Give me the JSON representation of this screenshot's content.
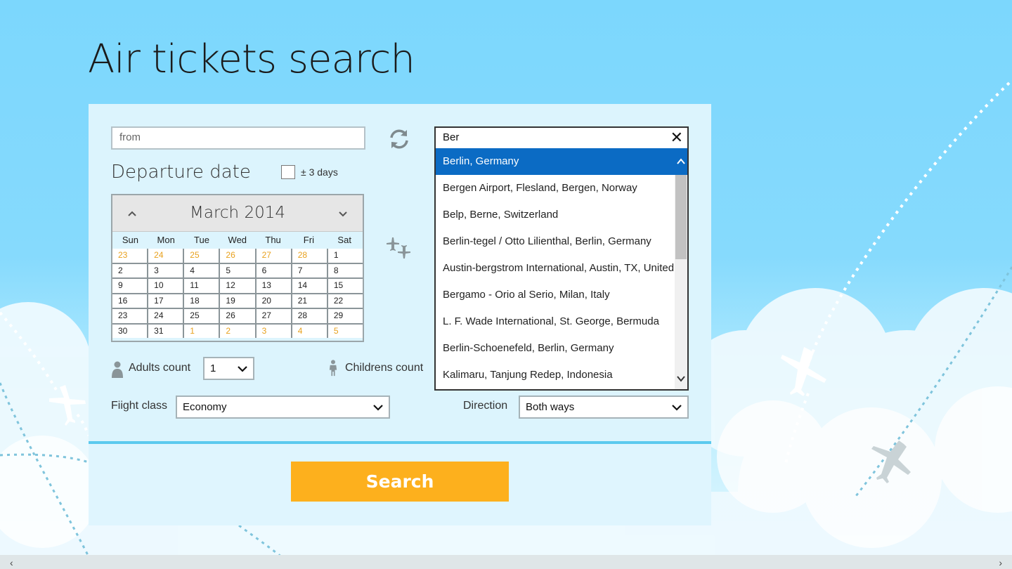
{
  "header": {
    "title": "Air tickets search"
  },
  "route": {
    "from_placeholder": "from",
    "to_value": "Ber",
    "clear_glyph": "✕"
  },
  "departure": {
    "label": "Departure date",
    "flex_days_label": "± 3 days",
    "flex_days_checked": false
  },
  "calendar": {
    "month_label": "March 2014",
    "weekdays": [
      "Sun",
      "Mon",
      "Tue",
      "Wed",
      "Thu",
      "Fri",
      "Sat"
    ],
    "days": [
      {
        "d": "23",
        "other": true
      },
      {
        "d": "24",
        "other": true
      },
      {
        "d": "25",
        "other": true
      },
      {
        "d": "26",
        "other": true
      },
      {
        "d": "27",
        "other": true
      },
      {
        "d": "28",
        "other": true
      },
      {
        "d": "1",
        "other": false
      },
      {
        "d": "2",
        "other": false
      },
      {
        "d": "3",
        "other": false
      },
      {
        "d": "4",
        "other": false
      },
      {
        "d": "5",
        "other": false
      },
      {
        "d": "6",
        "other": false
      },
      {
        "d": "7",
        "other": false
      },
      {
        "d": "8",
        "other": false
      },
      {
        "d": "9",
        "other": false
      },
      {
        "d": "10",
        "other": false
      },
      {
        "d": "11",
        "other": false
      },
      {
        "d": "12",
        "other": false
      },
      {
        "d": "13",
        "other": false
      },
      {
        "d": "14",
        "other": false
      },
      {
        "d": "15",
        "other": false
      },
      {
        "d": "16",
        "other": false
      },
      {
        "d": "17",
        "other": false
      },
      {
        "d": "18",
        "other": false
      },
      {
        "d": "19",
        "other": false
      },
      {
        "d": "20",
        "other": false
      },
      {
        "d": "21",
        "other": false
      },
      {
        "d": "22",
        "other": false
      },
      {
        "d": "23",
        "other": false
      },
      {
        "d": "24",
        "other": false
      },
      {
        "d": "25",
        "other": false
      },
      {
        "d": "26",
        "other": false
      },
      {
        "d": "27",
        "other": false
      },
      {
        "d": "28",
        "other": false
      },
      {
        "d": "29",
        "other": false
      },
      {
        "d": "30",
        "other": false
      },
      {
        "d": "31",
        "other": false
      },
      {
        "d": "1",
        "other": true
      },
      {
        "d": "2",
        "other": true
      },
      {
        "d": "3",
        "other": true
      },
      {
        "d": "4",
        "other": true
      },
      {
        "d": "5",
        "other": true
      }
    ]
  },
  "suggestions": {
    "items": [
      "Berlin, Germany",
      "Bergen Airport, Flesland, Bergen, Norway",
      "Belp, Berne, Switzerland",
      "Berlin-tegel / Otto Lilienthal, Berlin, Germany",
      "Austin-bergstrom International, Austin, TX, United",
      "Bergamo - Orio al Serio, Milan, Italy",
      "L. F. Wade International, St. George, Bermuda",
      "Berlin-Schoenefeld, Berlin, Germany",
      "Kalimaru, Tanjung Redep, Indonesia"
    ],
    "selected_index": 0
  },
  "passengers": {
    "adults_label": "Adults count",
    "adults_value": "1",
    "children_label": "Childrens count"
  },
  "options": {
    "class_label": "Fiight class",
    "class_value": "Economy",
    "direction_label": "Direction",
    "direction_value": "Both ways"
  },
  "actions": {
    "search_label": "Search"
  },
  "scrollbar": {
    "left_glyph": "‹",
    "right_glyph": "›"
  },
  "colors": {
    "accent_orange": "#fdb01d",
    "selection_blue": "#0b6bc4",
    "sky_blue": "#7cd7fd",
    "panel": "#dcf4fd",
    "divider": "#5bc9ee",
    "other_month_day": "#e8a11e"
  },
  "icons": {
    "swap": "swap-arrows-icon",
    "planes": "planes-icon",
    "adult": "adult-person-icon",
    "child": "child-person-icon",
    "chevron": "chevron-down-icon",
    "calendar_prev": "chevron-up-icon",
    "calendar_next": "chevron-down-icon"
  }
}
